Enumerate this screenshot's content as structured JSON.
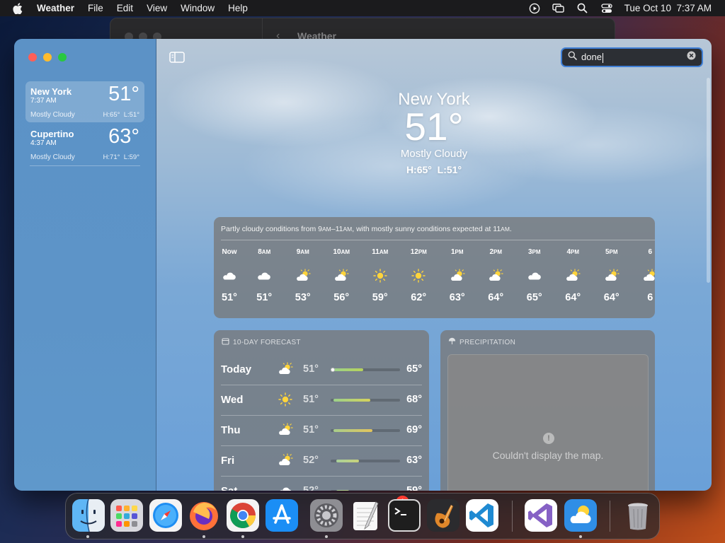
{
  "menubar": {
    "app_name": "Weather",
    "menus": [
      "File",
      "Edit",
      "View",
      "Window",
      "Help"
    ],
    "datetime": "Tue Oct 10  7:37 AM",
    "icons": [
      "apple-icon",
      "play-icon",
      "screen-mirroring-icon",
      "search-icon",
      "control-center-icon"
    ]
  },
  "background_window": {
    "title": "Weather"
  },
  "sidebar": {
    "cities": [
      {
        "name": "New York",
        "time": "7:37 AM",
        "temp": "51°",
        "condition": "Mostly Cloudy",
        "high": "H:65°",
        "low": "L:51°",
        "selected": true
      },
      {
        "name": "Cupertino",
        "time": "4:37 AM",
        "temp": "63°",
        "condition": "Mostly Cloudy",
        "high": "H:71°",
        "low": "L:59°",
        "selected": false
      }
    ]
  },
  "search": {
    "value": "done"
  },
  "hero": {
    "city": "New York",
    "temp": "51°",
    "condition": "Mostly Cloudy",
    "high": "H:65°",
    "low": "L:51°"
  },
  "hourly": {
    "summary_before": "Partly cloudy conditions from 9",
    "summary_am1": "AM",
    "summary_mid": "–11",
    "summary_am2": "AM",
    "summary_after": ", with mostly sunny conditions expected at 11",
    "summary_am3": "AM",
    "summary_end": ".",
    "hours": [
      {
        "num": "Now",
        "suffix": "",
        "icon": "cloud-icon",
        "temp": "51°"
      },
      {
        "num": "8",
        "suffix": "AM",
        "icon": "cloud-icon",
        "temp": "51°"
      },
      {
        "num": "9",
        "suffix": "AM",
        "icon": "partly-sunny-icon",
        "temp": "53°"
      },
      {
        "num": "10",
        "suffix": "AM",
        "icon": "partly-sunny-icon",
        "temp": "56°"
      },
      {
        "num": "11",
        "suffix": "AM",
        "icon": "sun-icon",
        "temp": "59°"
      },
      {
        "num": "12",
        "suffix": "PM",
        "icon": "sun-icon",
        "temp": "62°"
      },
      {
        "num": "1",
        "suffix": "PM",
        "icon": "partly-sunny-icon",
        "temp": "63°"
      },
      {
        "num": "2",
        "suffix": "PM",
        "icon": "partly-sunny-icon",
        "temp": "64°"
      },
      {
        "num": "3",
        "suffix": "PM",
        "icon": "cloud-icon",
        "temp": "65°"
      },
      {
        "num": "4",
        "suffix": "PM",
        "icon": "partly-sunny-icon",
        "temp": "64°"
      },
      {
        "num": "5",
        "suffix": "PM",
        "icon": "partly-sunny-icon",
        "temp": "64°"
      },
      {
        "num": "6",
        "suffix": "",
        "icon": "partly-sunny-icon",
        "temp": "6"
      }
    ]
  },
  "forecast": {
    "header": "10-DAY FORECAST",
    "days": [
      {
        "day": "Today",
        "icon": "partly-sunny-icon",
        "low": "51°",
        "high": "65°",
        "range_start": 0.0,
        "range_end": 0.58,
        "current_marker": 0.0,
        "fill": "linear-gradient(90deg,#9bd18a,#b7d35a)"
      },
      {
        "day": "Wed",
        "icon": "sun-icon",
        "low": "51°",
        "high": "68°",
        "range_start": 0.0,
        "range_end": 0.72,
        "current_marker": null,
        "fill": "linear-gradient(90deg,#9bd18a,#d6d25c)"
      },
      {
        "day": "Thu",
        "icon": "partly-sunny-icon",
        "low": "51°",
        "high": "69°",
        "range_start": 0.0,
        "range_end": 0.76,
        "current_marker": null,
        "fill": "linear-gradient(90deg,#a7cd8b,#e3c45c)"
      },
      {
        "day": "Fri",
        "icon": "partly-sunny-icon",
        "low": "52°",
        "high": "63°",
        "range_start": 0.05,
        "range_end": 0.5,
        "current_marker": null,
        "fill": "linear-gradient(90deg,#a9d19a,#c9d27b)"
      },
      {
        "day": "Sat",
        "icon": "cloud-icon",
        "low": "52°",
        "high": "59°",
        "range_start": 0.05,
        "range_end": 0.3,
        "current_marker": null,
        "fill": "linear-gradient(90deg,#a9d19a,#b9d28b)"
      }
    ]
  },
  "precipitation": {
    "header": "PRECIPITATION",
    "message": "Couldn't display the map."
  },
  "dock": {
    "apps": [
      "Finder",
      "Launchpad",
      "Safari",
      "Firefox",
      "Chrome",
      "App Store",
      "System Settings",
      "TextEdit",
      "Terminal",
      "GarageBand",
      "Visual Studio Code",
      "Visual Studio",
      "Weather",
      "Trash"
    ],
    "badge": "1"
  },
  "colors": {
    "accent": "#3f7fd6",
    "sidebar": "#5c92c6",
    "card": "#787878"
  }
}
